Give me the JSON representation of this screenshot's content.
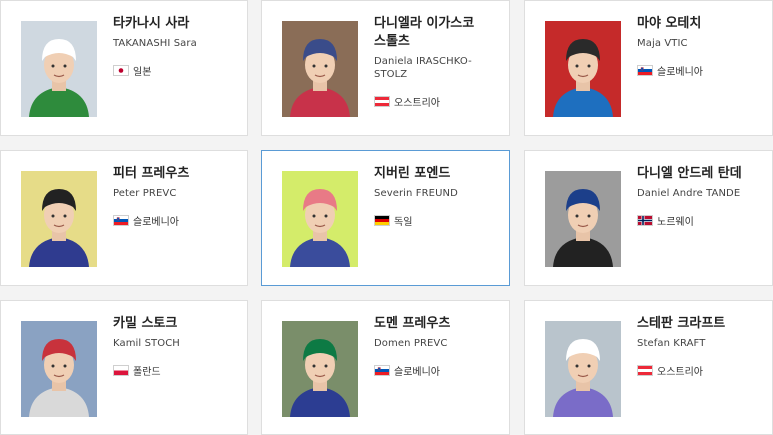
{
  "athletes": [
    {
      "name_ko": "타카나시 사라",
      "name_en": "TAKANASHI Sara",
      "country": "일본",
      "flag": "japan-flag-icon",
      "colors": {
        "suit": "#2e8b3c",
        "helmet": "#ffffff",
        "bg": "#cfd8e0"
      }
    },
    {
      "name_ko": "다니엘라 이가스코\n스톨츠",
      "name_en": "Daniela IRASCHKO-\nSTOLZ",
      "country": "오스트리아",
      "flag": "austria-flag-icon",
      "colors": {
        "suit": "#c8324a",
        "helmet": "#3a4c8a",
        "bg": "#8a6d57"
      }
    },
    {
      "name_ko": "마야 오테치",
      "name_en": "Maja VTIC",
      "country": "슬로베니아",
      "flag": "slovenia-flag-icon",
      "colors": {
        "suit": "#1e6fbf",
        "helmet": "#2a2a2a",
        "bg": "#c52a2a"
      }
    },
    {
      "name_ko": "피터 프레우츠",
      "name_en": "Peter PREVC",
      "country": "슬로베니아",
      "flag": "slovenia-flag-icon",
      "colors": {
        "suit": "#2f3b8f",
        "helmet": "#222222",
        "bg": "#e6dc88"
      }
    },
    {
      "name_ko": "지버린 포엔드",
      "name_en": "Severin FREUND",
      "country": "독일",
      "flag": "germany-flag-icon",
      "colors": {
        "suit": "#3a4c9c",
        "helmet": "#e87a86",
        "bg": "#d4ec6a"
      }
    },
    {
      "name_ko": "다니엘 안드레 탄데",
      "name_en": "Daniel Andre TANDE",
      "country": "노르웨이",
      "flag": "norway-flag-icon",
      "colors": {
        "suit": "#222222",
        "helmet": "#1c3f8a",
        "bg": "#9c9c9c"
      }
    },
    {
      "name_ko": "카밀 스토크",
      "name_en": "Kamil STOCH",
      "country": "폴란드",
      "flag": "poland-flag-icon",
      "colors": {
        "suit": "#d9d9d9",
        "helmet": "#c8323c",
        "bg": "#8aa2c2"
      }
    },
    {
      "name_ko": "도멘 프레우츠",
      "name_en": "Domen PREVC",
      "country": "슬로베니아",
      "flag": "slovenia-flag-icon",
      "colors": {
        "suit": "#2c3d92",
        "helmet": "#0d7a44",
        "bg": "#7a8e6a"
      }
    },
    {
      "name_ko": "스테판 크라프트",
      "name_en": "Stefan KRAFT",
      "country": "오스트리아",
      "flag": "austria-flag-icon",
      "colors": {
        "suit": "#7a6cc8",
        "helmet": "#ffffff",
        "bg": "#b9c4cc"
      }
    }
  ],
  "selected_index": 4
}
